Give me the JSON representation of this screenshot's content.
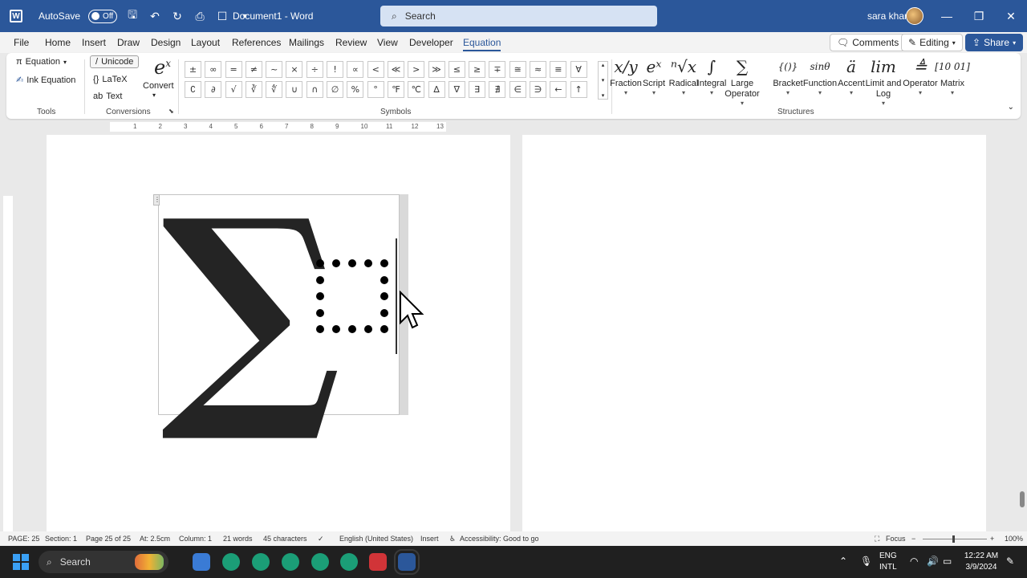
{
  "titlebar": {
    "autosave_label": "AutoSave",
    "autosave_state": "Off",
    "document_title": "Document1 - Word",
    "search_placeholder": "Search",
    "user_name": "sara khan"
  },
  "tabs": [
    "File",
    "Home",
    "Insert",
    "Draw",
    "Design",
    "Layout",
    "References",
    "Mailings",
    "Review",
    "View",
    "Developer",
    "Equation"
  ],
  "active_tab": "Equation",
  "menu_actions": {
    "comments": "Comments",
    "editing": "Editing",
    "share": "Share"
  },
  "ribbon": {
    "tools": {
      "equation": "Equation",
      "ink_equation": "Ink Equation",
      "label": "Tools"
    },
    "conversions": {
      "unicode": "Unicode",
      "latex": "LaTeX",
      "text": "Text",
      "convert": "Convert",
      "label": "Conversions"
    },
    "symbols": {
      "label": "Symbols",
      "items": [
        "±",
        "∞",
        "=",
        "≠",
        "~",
        "×",
        "÷",
        "!",
        "∝",
        "<",
        "≪",
        ">",
        "≫",
        "≤",
        "≥",
        "∓",
        "≅",
        "≈",
        "≡",
        "∀",
        "∁",
        "∂",
        "√",
        "∛",
        "∜",
        "∪",
        "∩",
        "∅",
        "%",
        "°",
        "℉",
        "℃",
        "∆",
        "∇",
        "∃",
        "∄",
        "∈",
        "∋",
        "←",
        "↑"
      ]
    },
    "structures": {
      "label": "Structures",
      "items": [
        {
          "label": "Fraction",
          "icon": "fraction-icon",
          "glyph": "x/y"
        },
        {
          "label": "Script",
          "icon": "script-icon",
          "glyph": "eˣ"
        },
        {
          "label": "Radical",
          "icon": "radical-icon",
          "glyph": "ⁿ√x"
        },
        {
          "label": "Integral",
          "icon": "integral-icon",
          "glyph": "∫"
        },
        {
          "label": "Large Operator",
          "icon": "large-operator-icon",
          "glyph": "∑"
        },
        {
          "label": "Bracket",
          "icon": "bracket-icon",
          "glyph": "{()}"
        },
        {
          "label": "Function",
          "icon": "function-icon",
          "glyph": "sinθ"
        },
        {
          "label": "Accent",
          "icon": "accent-icon",
          "glyph": "ä"
        },
        {
          "label": "Limit and Log",
          "icon": "limit-icon",
          "glyph": "lim"
        },
        {
          "label": "Operator",
          "icon": "operator-icon",
          "glyph": "≜"
        },
        {
          "label": "Matrix",
          "icon": "matrix-icon",
          "glyph": "[10 01]"
        }
      ]
    }
  },
  "ruler_numbers": [
    "1",
    "2",
    "3",
    "4",
    "5",
    "6",
    "7",
    "8",
    "9",
    "10",
    "11",
    "12",
    "13"
  ],
  "equation": {
    "operator": "∑"
  },
  "statusbar": {
    "page": "PAGE: 25",
    "section": "Section: 1",
    "page_of": "Page 25 of 25",
    "at": "At: 2.5cm",
    "column": "Column: 1",
    "words": "21 words",
    "characters": "45 characters",
    "language": "English (United States)",
    "mode": "Insert",
    "accessibility": "Accessibility: Good to go",
    "focus": "Focus",
    "zoom": "100%"
  },
  "taskbar": {
    "search": "Search",
    "lang_line1": "ENG",
    "lang_line2": "INTL",
    "time": "12:22 AM",
    "date": "3/9/2024"
  },
  "colors": {
    "word_blue": "#2b579a",
    "taskbar": "#202020"
  }
}
